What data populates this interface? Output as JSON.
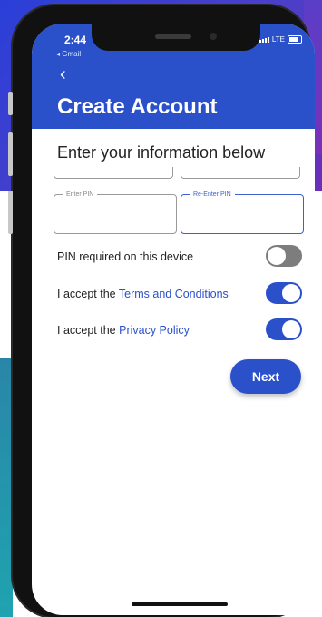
{
  "status_bar": {
    "time": "2:44",
    "back_app": "◂ Gmail",
    "network": "LTE"
  },
  "header": {
    "back_icon": "chevron-left-icon",
    "title": "Create Account"
  },
  "form": {
    "subtitle": "Enter your information below",
    "pin_label": "Enter PIN",
    "reenter_pin_label": "Re-Enter PIN"
  },
  "settings": {
    "pin_required": {
      "label": "PIN required on this device",
      "on": false
    },
    "terms": {
      "prefix": "I accept the ",
      "link": "Terms and Conditions",
      "on": true
    },
    "privacy": {
      "prefix": "I accept the ",
      "link": "Privacy Policy",
      "on": true
    }
  },
  "actions": {
    "next_label": "Next"
  },
  "colors": {
    "primary": "#2a51c9",
    "toggle_off": "#7d7d7d"
  }
}
